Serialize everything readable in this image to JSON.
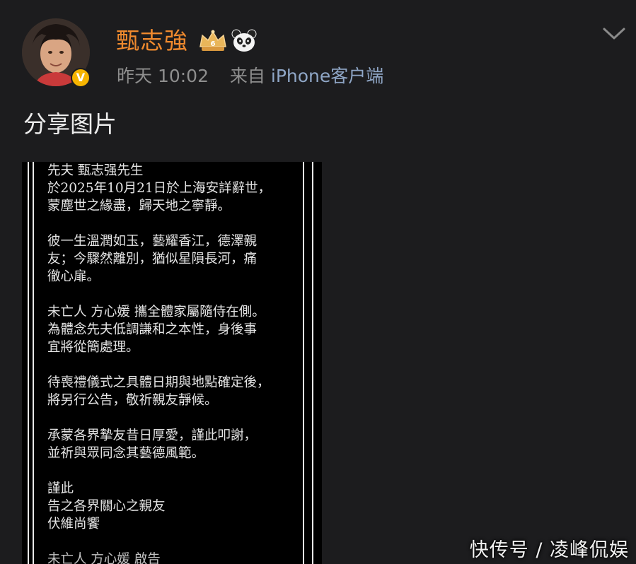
{
  "post": {
    "username": "甄志強",
    "timestamp": "昨天 10:02",
    "source_prefix": "来自",
    "source_name": "iPhone客户端",
    "text": "分享图片",
    "badges": [
      "crown-badge",
      "panda-badge"
    ],
    "verified_mark": "V"
  },
  "notice": {
    "paragraphs": [
      [
        "先夫 甄志强先生",
        "於2025年10月21日於上海安詳辭世，",
        "蒙塵世之緣盡，歸天地之寧靜。"
      ],
      [
        "彼一生溫潤如玉，藝耀香江，德澤親",
        "友；今驟然離別，猶似星隕長河，痛",
        "徹心扉。"
      ],
      [
        "未亡人 方心媛 攜全體家屬隨侍在側。",
        "為體念先夫低調謙和之本性，身後事",
        "宜將從簡處理。"
      ],
      [
        "待喪禮儀式之具體日期與地點確定後，",
        "將另行公告，敬祈親友靜候。"
      ],
      [
        "承蒙各界摯友昔日厚愛，謹此叩謝，",
        "並祈與眾同念其藝德風範。"
      ],
      [
        "謹此",
        "告之各界關心之親友",
        "伏維尚饗"
      ]
    ],
    "cut_line": "未亡人 方心媛 啟告"
  },
  "watermark": "快传号 / 凌峰侃娱",
  "colors": {
    "background": "#1c1c1e",
    "username": "#f08a2e",
    "meta": "#8e8e8e",
    "verified": "#f6b400"
  },
  "icons": {
    "menu": "chevron-down-icon"
  }
}
